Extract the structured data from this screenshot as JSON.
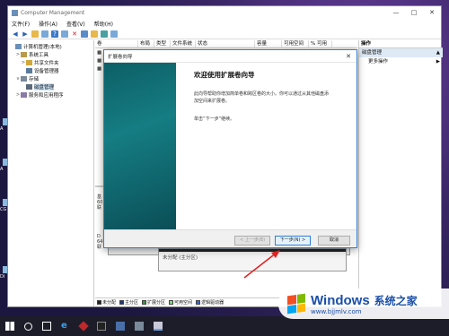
{
  "window": {
    "title": "Computer Management",
    "buttons": {
      "minimize": "—",
      "maximize": "□",
      "close": "✕"
    }
  },
  "menubar": [
    "文件(F)",
    "操作(A)",
    "查看(V)",
    "帮助(H)"
  ],
  "tree": [
    {
      "label": "计算机管理(本地)",
      "level": 0,
      "expander": "",
      "icon": "computer-icon"
    },
    {
      "label": "系统工具",
      "level": 1,
      "expander": ">",
      "icon": "tools-icon"
    },
    {
      "label": "共享文件夹",
      "level": 2,
      "expander": ">",
      "icon": "shared-folder-icon"
    },
    {
      "label": "设备管理器",
      "level": 2,
      "expander": "",
      "icon": "device-manager-icon"
    },
    {
      "label": "存储",
      "level": 1,
      "expander": "v",
      "icon": "storage-icon"
    },
    {
      "label": "磁盘管理",
      "level": 2,
      "expander": "",
      "icon": "disk-icon",
      "selected": true
    },
    {
      "label": "服务和应用程序",
      "level": 1,
      "expander": ">",
      "icon": "services-icon"
    }
  ],
  "columns": [
    "卷",
    "布局",
    "类型",
    "文件系统",
    "状态",
    "容量",
    "可用空间",
    "% 可用"
  ],
  "volume_rows": [
    "■",
    "■",
    "■"
  ],
  "disks": [
    {
      "name": "基\n60\n联"
    },
    {
      "name": "D\n64\n联"
    }
  ],
  "unallocated_label": "未分配 (主分区)",
  "legend": [
    {
      "label": "未分配",
      "color": "#222222"
    },
    {
      "label": "主分区",
      "color": "#1a3a8a"
    },
    {
      "label": "扩展分区",
      "color": "#3a9a3a"
    },
    {
      "label": "可用空间",
      "color": "#7ed87e"
    },
    {
      "label": "逻辑驱动器",
      "color": "#3a6ad8"
    }
  ],
  "actions": {
    "header": "操作",
    "section": "磁盘管理",
    "more": "更多操作"
  },
  "wizard": {
    "title": "扩展卷向导",
    "heading": "欢迎使用扩展卷向导",
    "description": "此向导帮助你增加简单卷和跨区卷的大小。你可以通过从其他磁盘添加空间来扩展卷。",
    "next_hint": "单击“下一步”继续。",
    "buttons": {
      "prev": "< 上一步(B)",
      "next": "下一步(N) >",
      "cancel": "取消"
    },
    "close": "✕"
  },
  "watermark": {
    "brand": "Windows",
    "cn": "系统之家",
    "url": "www.bjjmlv.com"
  },
  "desktop_icons": [
    "A",
    "A",
    "CG",
    "Di"
  ],
  "accent_colors": {
    "wizard_banner": "#157d83",
    "selection": "#cce4f7",
    "arrow": "#e02020"
  }
}
